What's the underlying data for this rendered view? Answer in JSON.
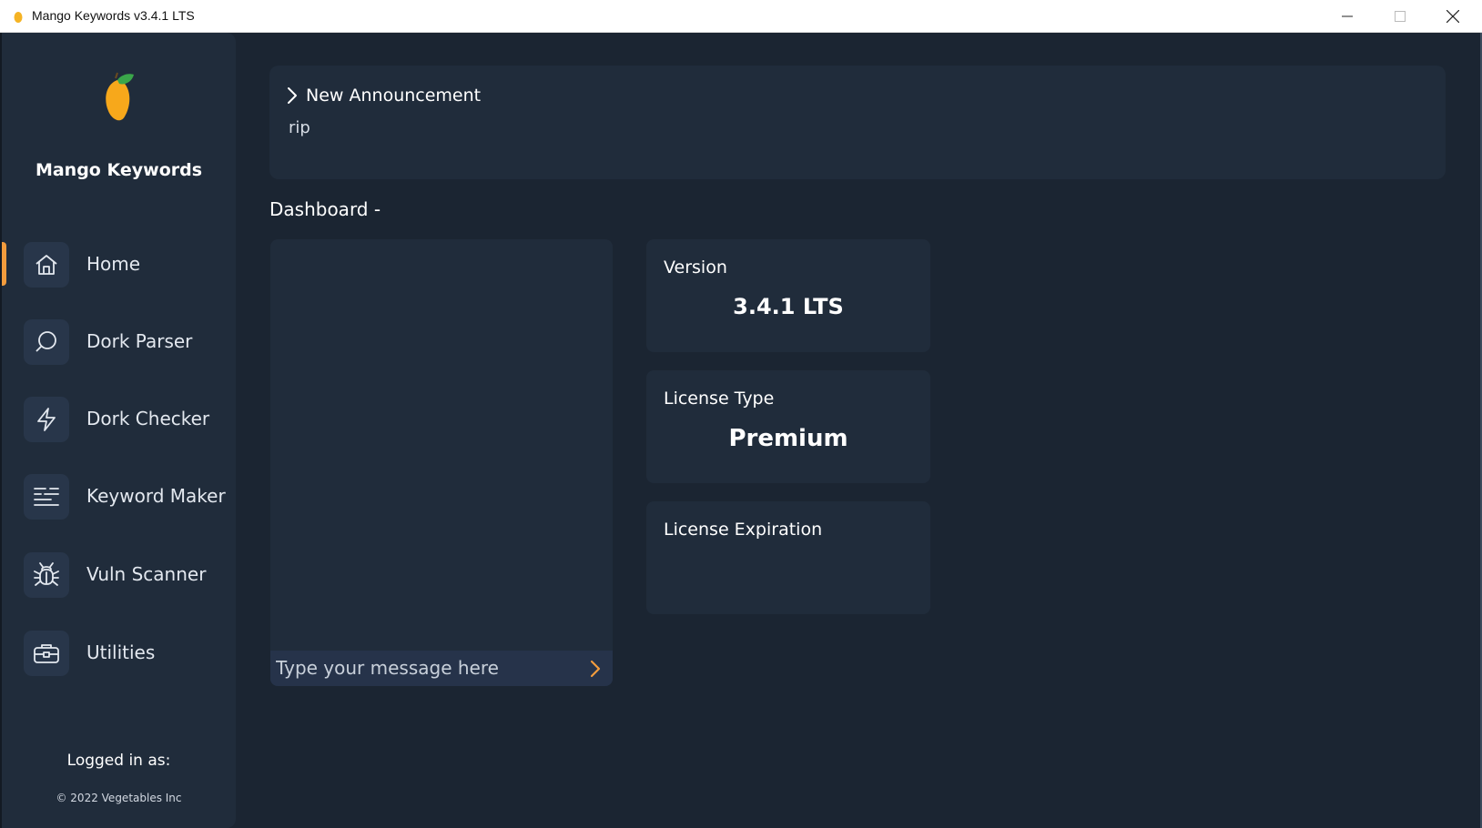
{
  "window": {
    "title": "Mango Keywords v3.4.1 LTS",
    "icon": "mango-icon",
    "controls": [
      "minimize-icon",
      "maximize-icon",
      "close-icon"
    ]
  },
  "sidebar": {
    "brand": "Mango Keywords",
    "items": [
      {
        "label": "Home",
        "icon": "home-icon",
        "active": true
      },
      {
        "label": "Dork Parser",
        "icon": "search-icon",
        "active": false
      },
      {
        "label": "Dork Checker",
        "icon": "lightning-icon",
        "active": false
      },
      {
        "label": "Keyword Maker",
        "icon": "text-lines-icon",
        "active": false
      },
      {
        "label": "Vuln Scanner",
        "icon": "bug-icon",
        "active": false
      },
      {
        "label": "Utilities",
        "icon": "toolbox-icon",
        "active": false
      }
    ],
    "logged_in_label": "Logged in as:",
    "copyright": "© 2022 Vegetables Inc"
  },
  "announcement": {
    "title": "New Announcement",
    "body": "rip"
  },
  "dashboard": {
    "title": "Dashboard -",
    "chat": {
      "placeholder": "Type your message here",
      "value": ""
    },
    "cards": [
      {
        "label": "Version",
        "value": "3.4.1 LTS"
      },
      {
        "label": "License Type",
        "value": "Premium"
      },
      {
        "label": "License Expiration",
        "value": ""
      }
    ]
  },
  "colors": {
    "background": "#1b2532",
    "panel": "#202c3b",
    "accent": "#f39c3d",
    "icon_box": "#28364a"
  }
}
